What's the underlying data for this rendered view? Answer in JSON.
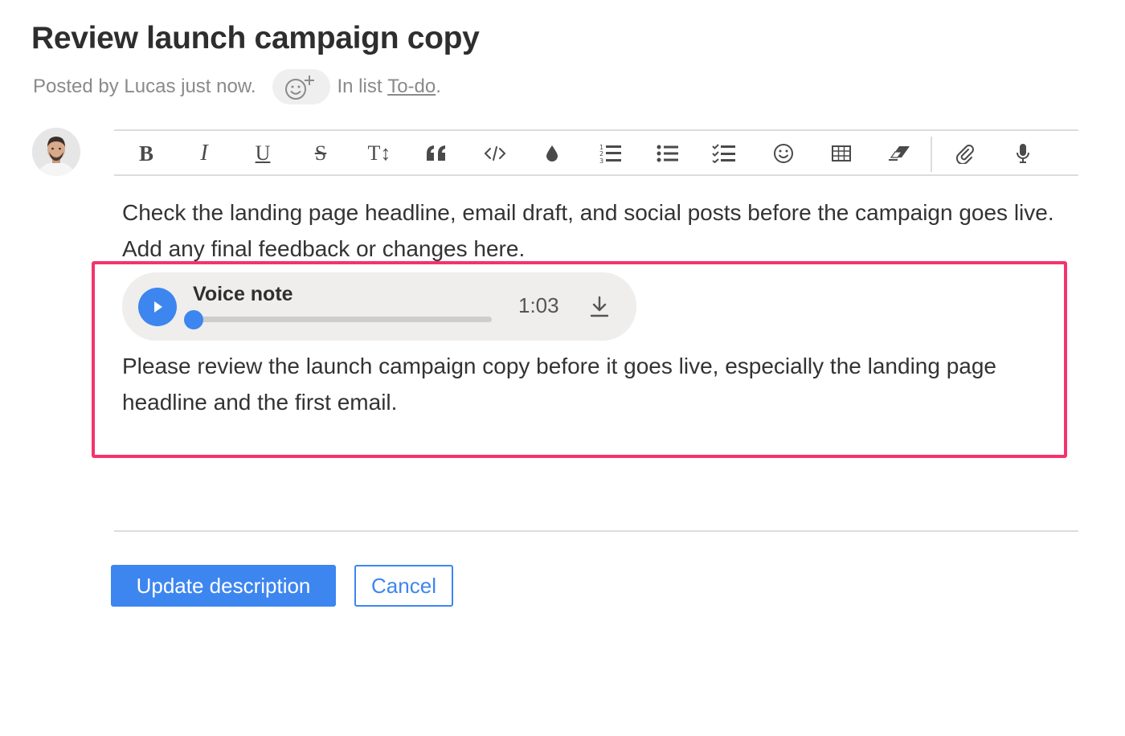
{
  "title": "Review launch campaign copy",
  "meta": {
    "posted_by": "Posted by Lucas just now.",
    "in_list_prefix": "In list",
    "list_name": "To-do",
    "list_suffix": "."
  },
  "toolbar": {
    "icons": [
      "bold-icon",
      "italic-icon",
      "underline-icon",
      "strikethrough-icon",
      "heading-icon",
      "quote-icon",
      "code-icon",
      "color-icon",
      "numbered-list-icon",
      "bulleted-list-icon",
      "checklist-icon",
      "emoji-icon",
      "table-icon",
      "clear-format-icon",
      "attachment-icon",
      "microphone-icon"
    ],
    "bold": "B",
    "italic": "I",
    "underline": "U",
    "strike": "S",
    "heading": "T↕"
  },
  "body": {
    "paragraph1": "Check the landing page headline, email draft, and social posts before the campaign goes live. Add any final feedback or changes here.",
    "paragraph2": "Please review the launch campaign copy before it goes live, especially the landing page headline and the first email."
  },
  "voice_note": {
    "title": "Voice note",
    "duration": "1:03",
    "progress": 0
  },
  "buttons": {
    "update": "Update description",
    "cancel": "Cancel"
  },
  "colors": {
    "accent": "#3d86f0",
    "highlight": "#f4336c"
  }
}
